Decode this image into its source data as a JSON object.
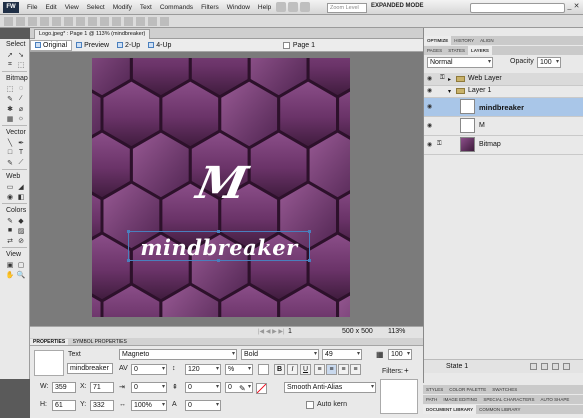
{
  "app": {
    "logo": "FW",
    "menu": [
      "File",
      "Edit",
      "View",
      "Select",
      "Modify",
      "Text",
      "Commands",
      "Filters",
      "Window",
      "Help"
    ],
    "zoom_placeholder": "Zoom Level",
    "mode": "EXPANDED MODE",
    "window_buttons": [
      "_",
      "□",
      "✕"
    ]
  },
  "document": {
    "tab_title": "Logo.jpeg* : Page 1 @ 113% (mindbreaker)",
    "views": [
      "Original",
      "Preview",
      "2-Up",
      "4-Up"
    ],
    "page": "Page 1",
    "art_monogram": "M",
    "art_wordmark": "mindbreaker"
  },
  "toolbar": {
    "sections": [
      "Select",
      "Bitmap",
      "Vector",
      "Web",
      "Colors",
      "View"
    ],
    "select_icons": [
      "➚",
      "➘",
      "⌗",
      "⬚"
    ],
    "bitmap_icons": [
      "⬚",
      "◌",
      "✎",
      "∕",
      "✱",
      "⌀",
      "▦",
      "☼"
    ],
    "vector_icons": [
      "╲",
      "✒",
      "□",
      "T",
      "✎",
      "⟋"
    ],
    "web_icons": [
      "▭",
      "◢",
      "◉",
      "◧"
    ],
    "colors_icons": [
      "✎",
      "◆",
      "■",
      "▨",
      "⇄",
      "⊘"
    ],
    "view_icons": [
      "▣",
      "▢",
      "✋",
      "🔍"
    ]
  },
  "status": {
    "page_number": "1",
    "canvas_size": "500 x 500",
    "zoom": "113%"
  },
  "properties": {
    "tabs": [
      "PROPERTIES",
      "SYMBOL PROPERTIES"
    ],
    "type_label": "Text",
    "name": "mindbreaker",
    "font": "Magneto",
    "style": "Bold",
    "size": "49",
    "kerning": "0",
    "leading": "120",
    "leading_unit": "%",
    "space_before": "0",
    "indent": "0",
    "space_after": "0",
    "baseline": "0",
    "horizontal_scale": "100%",
    "width_label": "W:",
    "width": "359",
    "x_label": "X:",
    "x": "71",
    "height_label": "H:",
    "height": "61",
    "y_label": "Y:",
    "y": "332",
    "antialias": "Smooth Anti-Alias",
    "auto_kern": "Auto kern",
    "opacity": "100",
    "filters_label": "Filters:",
    "bold_btn": "B",
    "italic_btn": "I",
    "underline_btn": "U",
    "text_color": "#ffffff"
  },
  "right_panel": {
    "top_tabs": [
      "OPTIMIZE",
      "HISTORY",
      "ALIGN"
    ],
    "layer_tabs": [
      "PAGES",
      "STATES",
      "LAYERS"
    ],
    "blend_mode": "Normal",
    "opacity_label": "Opacity",
    "opacity": "100",
    "layers": [
      {
        "name": "Web Layer",
        "type": "folder"
      },
      {
        "name": "Layer 1",
        "type": "folder"
      },
      {
        "name": "mindbreaker",
        "type": "text",
        "selected": true
      },
      {
        "name": "M",
        "type": "text"
      },
      {
        "name": "Bitmap",
        "type": "bitmap"
      }
    ],
    "state_name": "State 1",
    "bottom_tabs_1": [
      "STYLES",
      "COLOR PALETTE",
      "SWATCHES"
    ],
    "bottom_tabs_2": [
      "PATH",
      "IMAGE EDITING",
      "SPECIAL CHARACTERS",
      "AUTO SHAPE"
    ],
    "bottom_tabs_3": [
      "DOCUMENT LIBRARY",
      "COMMON LIBRARY"
    ]
  },
  "colors": {
    "accent": "#4a7fbd",
    "selected_layer": "#a9c6e8",
    "art_bg": "#5d2b5a"
  }
}
